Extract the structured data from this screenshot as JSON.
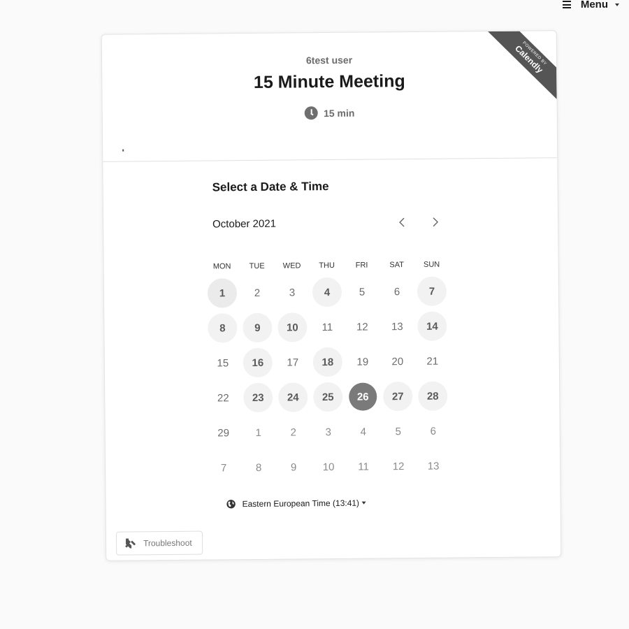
{
  "menu": {
    "label": "Menu"
  },
  "ribbon": {
    "powered_by": "POWERED BY",
    "brand": "Calendly"
  },
  "event": {
    "user_name": "6test user",
    "title": "15 Minute Meeting",
    "duration": "15 min"
  },
  "calendar": {
    "section_title": "Select a Date & Time",
    "month_label": "October 2021",
    "weekdays": [
      "MON",
      "TUE",
      "WED",
      "THU",
      "FRI",
      "SAT",
      "SUN"
    ],
    "weeks": [
      [
        {
          "d": "1",
          "s": "available"
        },
        {
          "d": "2",
          "s": "unavailable"
        },
        {
          "d": "3",
          "s": "unavailable"
        },
        {
          "d": "4",
          "s": "available"
        },
        {
          "d": "5",
          "s": "unavailable"
        },
        {
          "d": "6",
          "s": "unavailable"
        },
        {
          "d": "7",
          "s": "available"
        }
      ],
      [
        {
          "d": "8",
          "s": "available"
        },
        {
          "d": "9",
          "s": "available"
        },
        {
          "d": "10",
          "s": "available"
        },
        {
          "d": "11",
          "s": "unavailable"
        },
        {
          "d": "12",
          "s": "unavailable"
        },
        {
          "d": "13",
          "s": "unavailable"
        },
        {
          "d": "14",
          "s": "available"
        }
      ],
      [
        {
          "d": "15",
          "s": "unavailable"
        },
        {
          "d": "16",
          "s": "available"
        },
        {
          "d": "17",
          "s": "unavailable"
        },
        {
          "d": "18",
          "s": "available"
        },
        {
          "d": "19",
          "s": "unavailable"
        },
        {
          "d": "20",
          "s": "unavailable"
        },
        {
          "d": "21",
          "s": "unavailable"
        }
      ],
      [
        {
          "d": "22",
          "s": "unavailable"
        },
        {
          "d": "23",
          "s": "available"
        },
        {
          "d": "24",
          "s": "available"
        },
        {
          "d": "25",
          "s": "available"
        },
        {
          "d": "26",
          "s": "selected"
        },
        {
          "d": "27",
          "s": "available"
        },
        {
          "d": "28",
          "s": "available"
        }
      ],
      [
        {
          "d": "29",
          "s": "unavailable"
        },
        {
          "d": "1",
          "s": "other"
        },
        {
          "d": "2",
          "s": "other"
        },
        {
          "d": "3",
          "s": "other"
        },
        {
          "d": "4",
          "s": "other"
        },
        {
          "d": "5",
          "s": "other"
        },
        {
          "d": "6",
          "s": "other"
        }
      ],
      [
        {
          "d": "7",
          "s": "other"
        },
        {
          "d": "8",
          "s": "other"
        },
        {
          "d": "9",
          "s": "other"
        },
        {
          "d": "10",
          "s": "other"
        },
        {
          "d": "11",
          "s": "other"
        },
        {
          "d": "12",
          "s": "other"
        },
        {
          "d": "13",
          "s": "other"
        }
      ]
    ]
  },
  "timezone": {
    "label": "Eastern European Time (13:41)"
  },
  "troubleshoot": {
    "label": "Troubleshoot"
  },
  "colors": {
    "ribbon": "#555555",
    "selected_day": "#7a7a7a",
    "available_day_bg": "#f2f2f2"
  }
}
